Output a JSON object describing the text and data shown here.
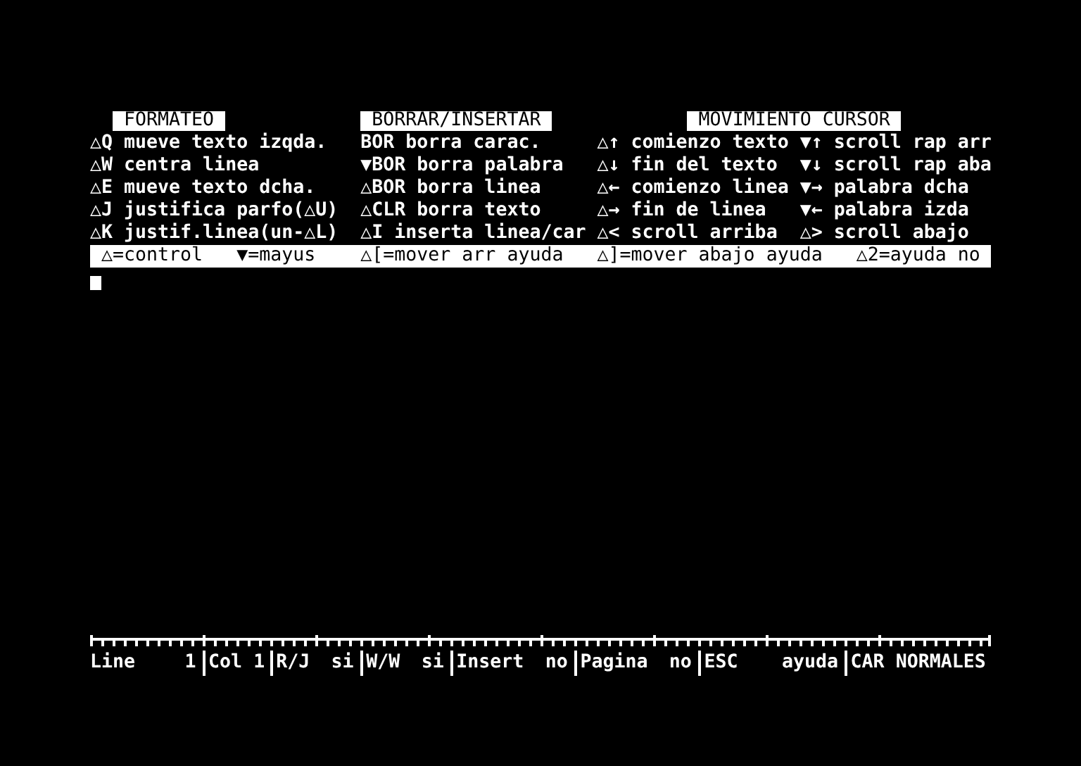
{
  "help_panel": {
    "headings": [
      "FORMATEO",
      "BORRAR/INSERTAR",
      "MOVIMIENTO CURSOR"
    ],
    "columns": [
      [
        "△Q mueve texto izqda.",
        "△W centra linea",
        "△E mueve texto dcha.",
        "△J justifica parfo(△U)",
        "△K justif.linea(un-△L)"
      ],
      [
        "BOR borra carac.",
        "▼BOR borra palabra",
        "△BOR borra linea",
        "△CLR borra texto",
        "△I inserta linea/car"
      ],
      [
        "△↑ comienzo texto",
        "△↓ fin del texto",
        "△← comienzo linea",
        "△→ fin de linea",
        "△< scroll arriba"
      ],
      [
        "▼↑ scroll rap arr",
        "▼↓ scroll rap aba",
        "▼→ palabra dcha",
        "▼← palabra izda",
        "△> scroll abajo"
      ]
    ],
    "key_bar": [
      "△=control",
      "▼=mayus",
      "△[=mover arr ayuda",
      "△]=mover abajo ayuda",
      "△2=ayuda no"
    ]
  },
  "status_bar": [
    {
      "label": "Line",
      "value": "1"
    },
    {
      "label": "Col",
      "value": "1"
    },
    {
      "label": "R/J",
      "value": "si"
    },
    {
      "label": "W/W",
      "value": "si"
    },
    {
      "label": "Insert",
      "value": "no"
    },
    {
      "label": "Pagina",
      "value": "no"
    },
    {
      "label": "ESC",
      "value": "ayuda"
    },
    {
      "label": "CAR NORMALES"
    }
  ]
}
